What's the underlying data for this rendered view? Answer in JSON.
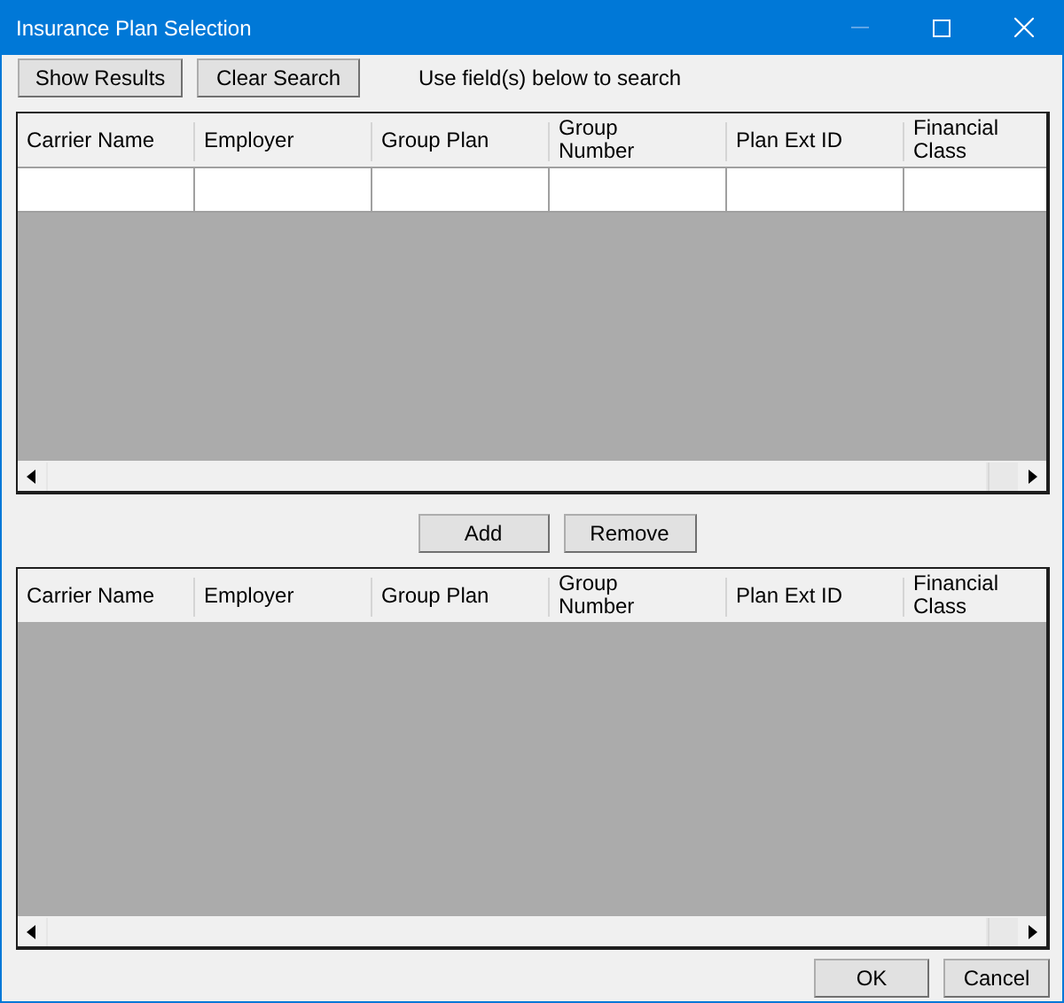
{
  "window": {
    "title": "Insurance Plan Selection",
    "controls": [
      {
        "kind": "minimize",
        "disabled": true
      },
      {
        "kind": "maximize",
        "disabled": false
      },
      {
        "kind": "close",
        "disabled": false
      }
    ]
  },
  "toolbar": {
    "buttons": [
      "Show Results",
      "Clear Search"
    ],
    "hint": "Use field(s) below to search"
  },
  "search_grid": {
    "columns": [
      "Carrier Name",
      "Employer",
      "Group Plan",
      "Group Number",
      "Plan Ext ID",
      "Financial Class"
    ],
    "filter_row": true
  },
  "middle_buttons": [
    "Add",
    "Remove"
  ],
  "selected_grid": {
    "columns": [
      "Carrier Name",
      "Employer",
      "Group Plan",
      "Group Number",
      "Plan Ext ID",
      "Financial Class"
    ],
    "filter_row": false
  },
  "footer_buttons": [
    "OK",
    "Cancel"
  ]
}
